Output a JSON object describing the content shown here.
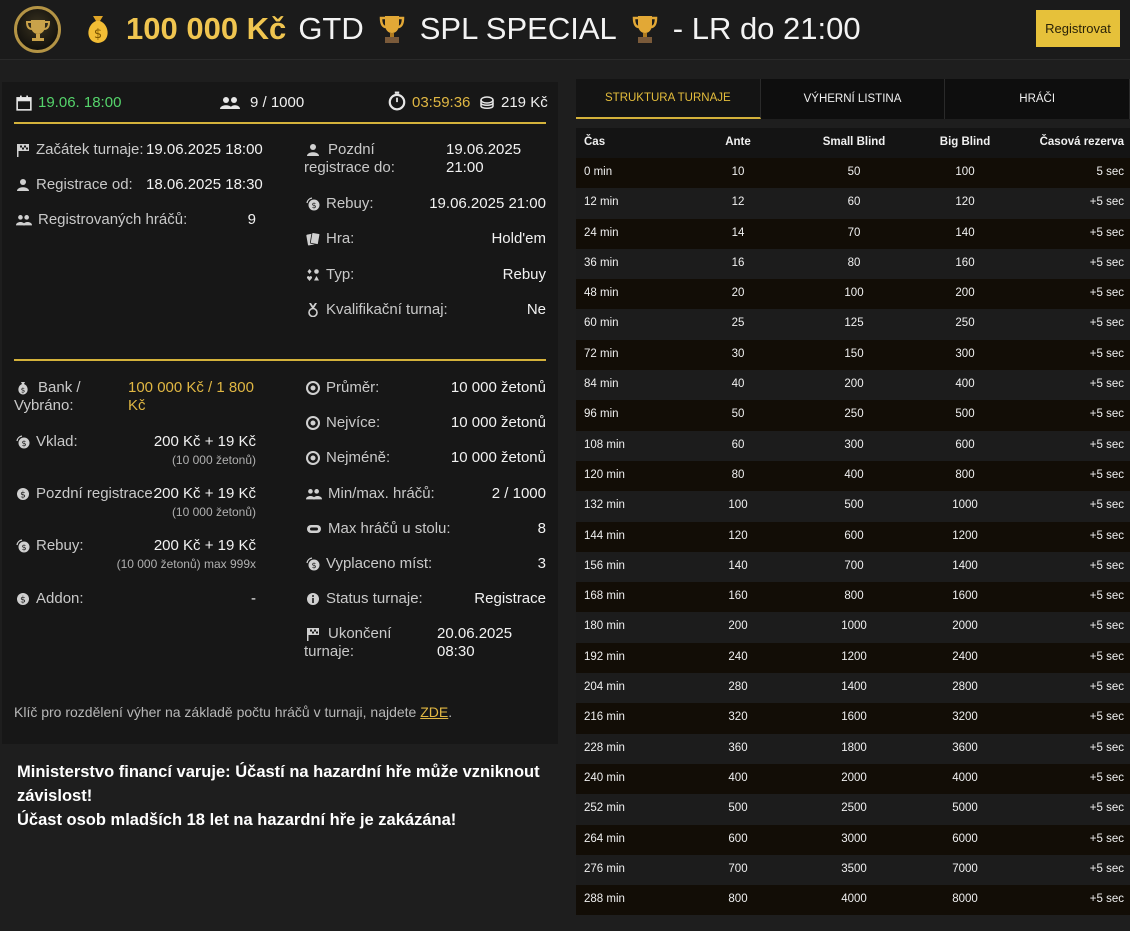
{
  "header": {
    "amount": "100 000 Kč",
    "gtd": "GTD",
    "name": "SPL SPECIAL",
    "suffix": "- LR do 21:00",
    "register_button": "Registrovat"
  },
  "info_bar": {
    "date": "19.06. 18:00",
    "players": "9 / 1000",
    "countdown": "03:59:36",
    "online": "219 Kč"
  },
  "details_left": [
    {
      "label": "Začátek turnaje:",
      "value": "19.06.2025 18:00"
    },
    {
      "label": "Registrace od:",
      "value": "18.06.2025 18:30"
    },
    {
      "label": "Registrovaných hráčů:",
      "value": "9"
    }
  ],
  "details_right": {
    "late_reg_label": "Pozdní registrace do:",
    "late_reg_value": "19.06.2025 21:00",
    "rows": [
      {
        "label": "Rebuy:",
        "value": "19.06.2025 21:00"
      },
      {
        "label": "Hra:",
        "value": "Hold'em"
      },
      {
        "label": "Typ:",
        "value": "Rebuy"
      },
      {
        "label": "Kvalifikační turnaj:",
        "value": "Ne"
      }
    ]
  },
  "finance": {
    "bank_label": "Bank / Vybráno:",
    "bank_value": "100 000 Kč / 1 800 Kč",
    "deposit_label": "Vklad:",
    "deposit_value": "200 Kč + 19 Kč",
    "deposit_sub": "(10 000 žetonů)",
    "late_label": "Pozdní registrace:",
    "late_value": "200 Kč + 19 Kč",
    "late_sub": "(10 000 žetonů)",
    "rebuy_label": "Rebuy:",
    "rebuy_value": "200 Kč + 19 Kč",
    "rebuy_sub": "(10 000 žetonů) max 999x",
    "addon_label": "Addon:",
    "addon_value": "-"
  },
  "stats": {
    "rows": [
      {
        "label": "Průměr:",
        "value": "10 000 žetonů"
      },
      {
        "label": "Nejvíce:",
        "value": "10 000 žetonů"
      },
      {
        "label": "Nejméně:",
        "value": "10 000 žetonů"
      },
      {
        "label": "Min/max. hráčů:",
        "value": "2 / 1000"
      },
      {
        "label": "Max hráčů u stolu:",
        "value": "8"
      },
      {
        "label": "Vyplaceno míst:",
        "value": "3"
      },
      {
        "label": "Status turnaje:",
        "value": "Registrace"
      }
    ],
    "end_label": "Ukončení turnaje:",
    "end_value": "20.06.2025 08:30"
  },
  "note": {
    "text": "Klíč pro rozdělení výher na základě počtu hráčů v turnaji, najdete ",
    "link": "ZDE",
    "dot": "."
  },
  "warning": {
    "line1": "Ministerstvo financí varuje: Účastí na hazardní hře může vzniknout závislost!",
    "line2": "Účast osob mladších 18 let na hazardní hře je zakázána!"
  },
  "tabs": [
    "STRUKTURA TURNAJE",
    "VÝHERNÍ LISTINA",
    "HRÁČI"
  ],
  "structure": {
    "columns": [
      "Čas",
      "Ante",
      "Small Blind",
      "Big Blind",
      "Časová rezerva"
    ],
    "rows": [
      [
        "0 min",
        "10",
        "50",
        "100",
        "5 sec"
      ],
      [
        "12 min",
        "12",
        "60",
        "120",
        "+5 sec"
      ],
      [
        "24 min",
        "14",
        "70",
        "140",
        "+5 sec"
      ],
      [
        "36 min",
        "16",
        "80",
        "160",
        "+5 sec"
      ],
      [
        "48 min",
        "20",
        "100",
        "200",
        "+5 sec"
      ],
      [
        "60 min",
        "25",
        "125",
        "250",
        "+5 sec"
      ],
      [
        "72 min",
        "30",
        "150",
        "300",
        "+5 sec"
      ],
      [
        "84 min",
        "40",
        "200",
        "400",
        "+5 sec"
      ],
      [
        "96 min",
        "50",
        "250",
        "500",
        "+5 sec"
      ],
      [
        "108 min",
        "60",
        "300",
        "600",
        "+5 sec"
      ],
      [
        "120 min",
        "80",
        "400",
        "800",
        "+5 sec"
      ],
      [
        "132 min",
        "100",
        "500",
        "1000",
        "+5 sec"
      ],
      [
        "144 min",
        "120",
        "600",
        "1200",
        "+5 sec"
      ],
      [
        "156 min",
        "140",
        "700",
        "1400",
        "+5 sec"
      ],
      [
        "168 min",
        "160",
        "800",
        "1600",
        "+5 sec"
      ],
      [
        "180 min",
        "200",
        "1000",
        "2000",
        "+5 sec"
      ],
      [
        "192 min",
        "240",
        "1200",
        "2400",
        "+5 sec"
      ],
      [
        "204 min",
        "280",
        "1400",
        "2800",
        "+5 sec"
      ],
      [
        "216 min",
        "320",
        "1600",
        "3200",
        "+5 sec"
      ],
      [
        "228 min",
        "360",
        "1800",
        "3600",
        "+5 sec"
      ],
      [
        "240 min",
        "400",
        "2000",
        "4000",
        "+5 sec"
      ],
      [
        "252 min",
        "500",
        "2500",
        "5000",
        "+5 sec"
      ],
      [
        "264 min",
        "600",
        "3000",
        "6000",
        "+5 sec"
      ],
      [
        "276 min",
        "700",
        "3500",
        "7000",
        "+5 sec"
      ],
      [
        "288 min",
        "800",
        "4000",
        "8000",
        "+5 sec"
      ]
    ]
  },
  "colors": {
    "accent": "#d4b23b",
    "green": "#55d46b",
    "gold_text": "#e0b743"
  }
}
